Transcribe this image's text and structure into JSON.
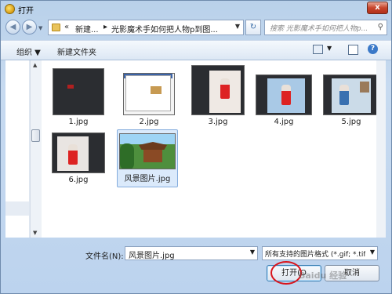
{
  "window": {
    "title": "打开",
    "close_label": "x"
  },
  "nav": {
    "back": "◀",
    "forward": "▶",
    "breadcrumb": {
      "prefix": "«",
      "part1": "新建...",
      "part2": "光影魔术手如何把人物p到图..."
    },
    "refresh": "↻",
    "search_placeholder": "搜索 光影魔术手如何把人物p..."
  },
  "toolbar": {
    "organize": "组织 ▼",
    "new_folder": "新建文件夹"
  },
  "files": [
    {
      "name": "1.jpg"
    },
    {
      "name": "2.jpg"
    },
    {
      "name": "3.jpg"
    },
    {
      "name": "4.jpg"
    },
    {
      "name": "5.jpg"
    },
    {
      "name": "6.jpg"
    },
    {
      "name": "风景图片.jpg",
      "selected": true
    }
  ],
  "bottom": {
    "filename_label": "文件名(N):",
    "filename_value": "风景图片.jpg",
    "filter_value": "所有支持的图片格式 (*.gif; *.tif",
    "open_button": "打开(O",
    "cancel_button": "取消"
  },
  "watermark": "Baidu 经验",
  "colors": {
    "selection": "#dbeafb",
    "highlight_circle": "#d8141c"
  }
}
